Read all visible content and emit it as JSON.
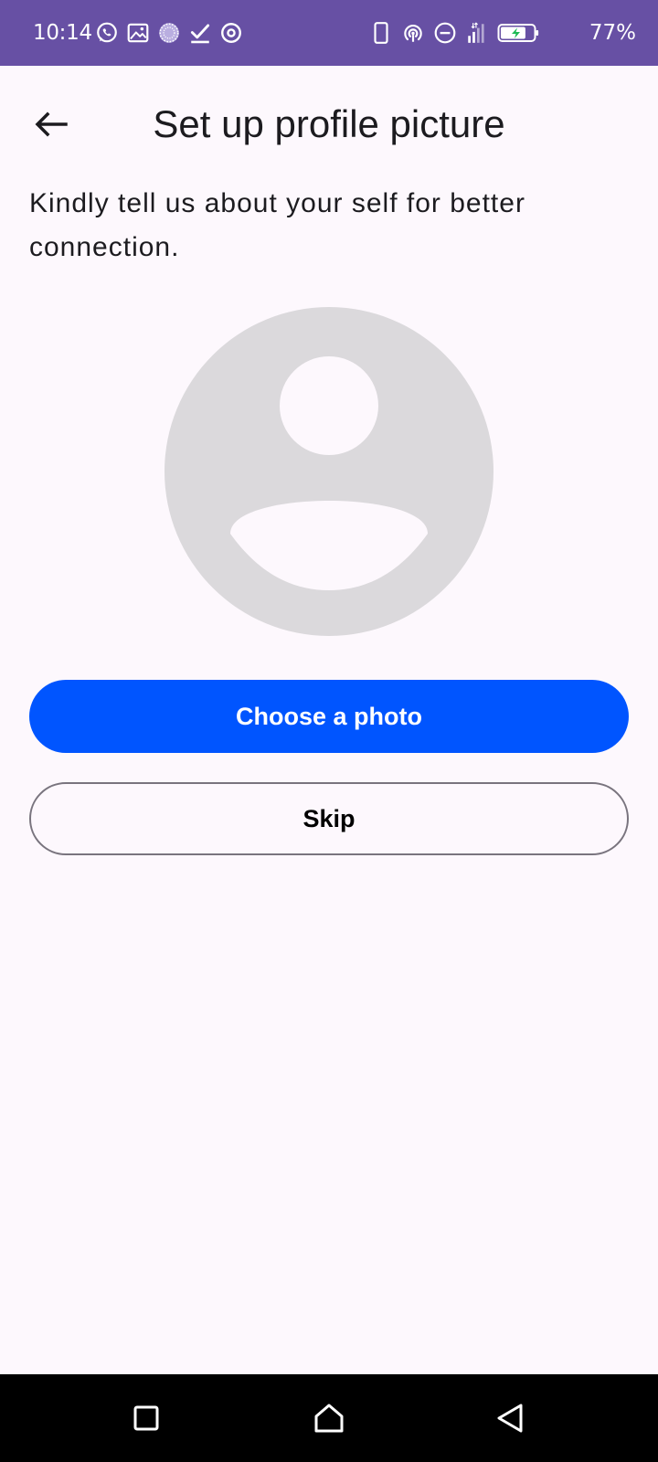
{
  "status_bar": {
    "time": "10:14",
    "battery_percent": "77%",
    "battery_level": 0.77,
    "charging": true,
    "left_icons": [
      "whatsapp-icon",
      "gallery-icon",
      "sync-icon",
      "check-icon",
      "target-icon"
    ],
    "right_icons": [
      "phone-outline-icon",
      "hotspot-icon",
      "do-not-disturb-icon",
      "signal-icon",
      "battery-icon"
    ],
    "background": "#6750a4"
  },
  "header": {
    "back_icon": "arrow-back-icon",
    "title": "Set up profile picture"
  },
  "subtitle": "Kindly tell us about your self for better connection.",
  "avatar": {
    "icon": "person-placeholder-icon",
    "color": "#dbd9dc"
  },
  "buttons": {
    "choose_photo": "Choose a photo",
    "skip": "Skip"
  },
  "colors": {
    "accent": "#0055ff",
    "background": "#fdf8fd",
    "outline": "#79747e"
  },
  "nav_bar": {
    "items": [
      "recents-square-icon",
      "home-icon",
      "back-triangle-icon"
    ]
  }
}
